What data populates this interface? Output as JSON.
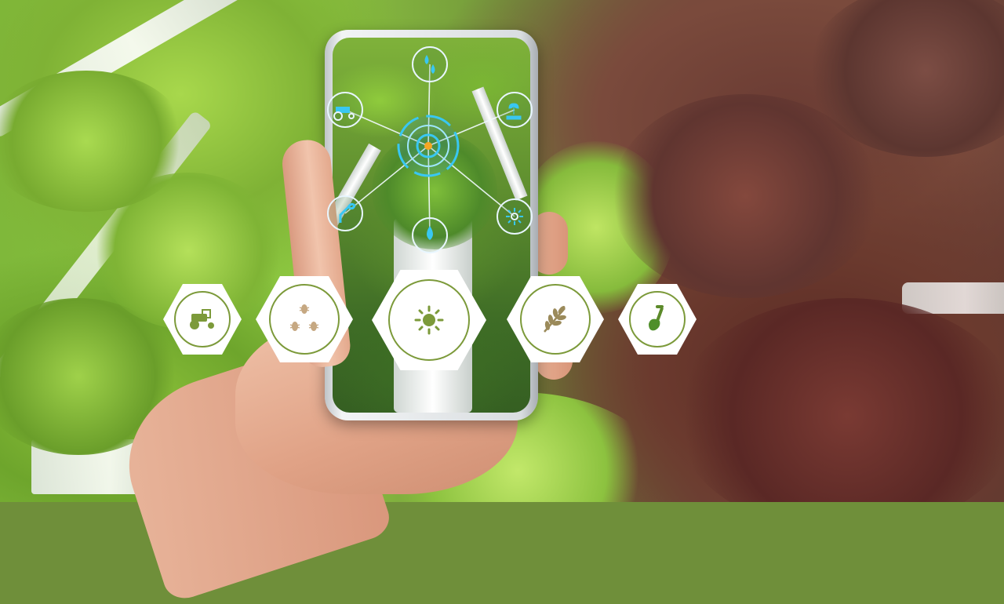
{
  "scene": {
    "description_tag": "hydroponic-lettuce-greenhouse",
    "accent_green": "#7c9a3a",
    "glow_blue": "#39c7f2"
  },
  "phone": {
    "screen_nodes": [
      {
        "icon": "tractor-icon"
      },
      {
        "icon": "water-drops-icon"
      },
      {
        "icon": "hand-plant-icon"
      },
      {
        "icon": "sprout-icon"
      },
      {
        "icon": "water-drop-icon"
      },
      {
        "icon": "sun-icon"
      }
    ]
  },
  "hex_icons": [
    {
      "icon": "tractor-icon"
    },
    {
      "icon": "bugs-icon"
    },
    {
      "icon": "sun-icon"
    },
    {
      "icon": "wheat-icon"
    },
    {
      "icon": "shovel-icon"
    }
  ]
}
